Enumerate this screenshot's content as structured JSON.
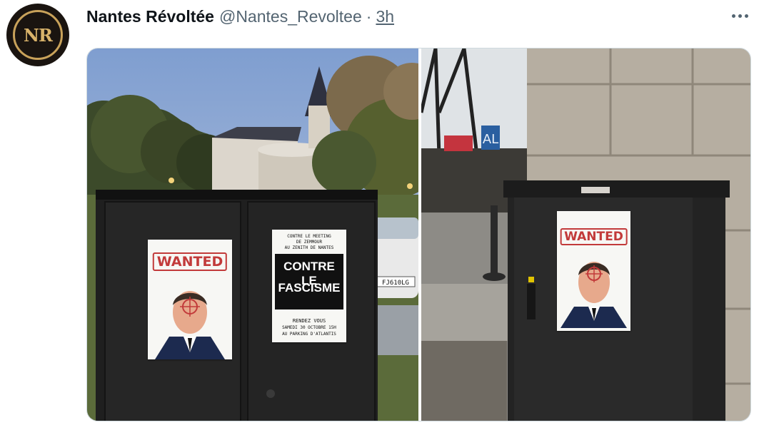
{
  "tweet": {
    "avatar_initials": "NR",
    "display_name": "Nantes Révoltée",
    "handle": "@Nantes_Revoltee",
    "separator": "·",
    "time": "3h",
    "more_icon": "more-options-icon"
  },
  "media": {
    "left_photo": {
      "poster_wanted": "WANTED",
      "poster_top_1": "CONTRE LE MEETING",
      "poster_top_2": "DE ZEMMOUR",
      "poster_top_3": "AU ZENITH DE NANTES",
      "poster_main_1": "CONTRE LE",
      "poster_main_2": "FASCISME",
      "poster_bottom_1": "RENDEZ VOUS",
      "poster_bottom_2": "SAMEDI 30 OCTOBRE 15H",
      "poster_bottom_3": "AU PARKING D'ATLANTIS",
      "license_plate": "FJ610LG"
    },
    "right_photo": {
      "poster_wanted": "WANTED",
      "graffiti_text": "AL"
    }
  },
  "colors": {
    "text_primary": "#0f1419",
    "text_secondary": "#536471",
    "avatar_gold": "#c9a25a",
    "wanted_red": "#c23a3a"
  }
}
